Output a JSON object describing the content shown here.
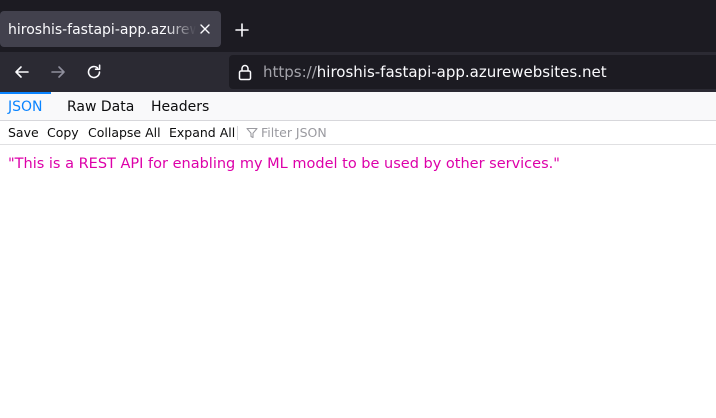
{
  "browser": {
    "tab": {
      "title": "hiroshis-fastapi-app.azurewebsites.net"
    },
    "url": {
      "scheme": "https://",
      "host": "hiroshis-fastapi-app.azurewebsites.net"
    }
  },
  "viewer": {
    "tabs": [
      {
        "label": "JSON"
      },
      {
        "label": "Raw Data"
      },
      {
        "label": "Headers"
      }
    ],
    "toolbar": {
      "save": "Save",
      "copy": "Copy",
      "collapse_all": "Collapse All",
      "expand_all": "Expand All",
      "filter_placeholder": "Filter JSON"
    },
    "json_value": "\"This is a REST API for enabling my ML model to be used by other services.\""
  },
  "icons": {
    "close": "close-icon",
    "new_tab": "plus-icon",
    "back": "arrow-left-icon",
    "forward": "arrow-right-icon",
    "reload": "reload-icon",
    "lock": "lock-icon",
    "filter": "filter-icon"
  },
  "colors": {
    "tabbar_bg": "#1c1b22",
    "navbar_bg": "#2b2a33",
    "active_tab": "#0a84ff",
    "json_string": "#dd00a9"
  }
}
